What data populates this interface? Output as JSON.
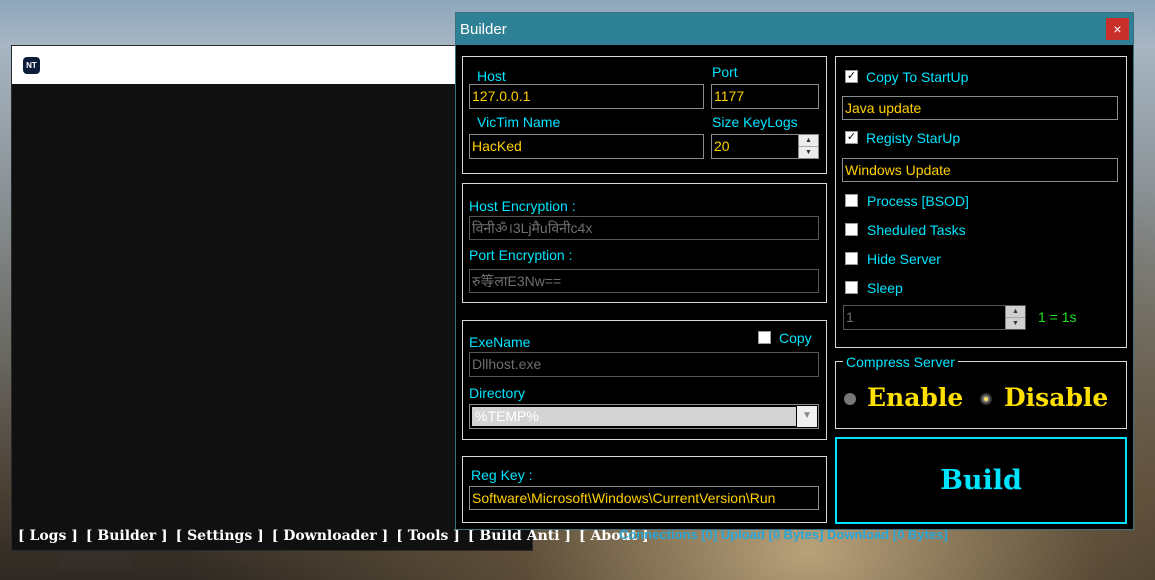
{
  "main": {
    "logo_text": "NT",
    "menu": [
      "[ Logs ]",
      "[ Builder ]",
      "[ Settings ]",
      "[ Downloader ]",
      "[ Tools ]",
      "[ Build Anti ]",
      "[ About ]"
    ],
    "status": "Connections [0]   Upload [0 Bytes]   Download [0 Bytes]"
  },
  "builder": {
    "title": "Builder",
    "close": "×",
    "host_label": "Host",
    "host_value": "127.0.0.1",
    "port_label": "Port",
    "port_value": "1177",
    "victim_label": "VicTim Name",
    "victim_value": "HacKed",
    "keylogs_label": "Size KeyLogs",
    "keylogs_value": "20",
    "host_enc_label": "Host Encryption :",
    "host_enc_value": "विनीॐ।3Ljमैuविनीc4x",
    "port_enc_label": "Port Encryption :",
    "port_enc_value": "रु等लाE3Nw==",
    "exename_label": "ExeName",
    "exename_value": "Dllhost.exe",
    "copy_label": "Copy",
    "directory_label": "Directory",
    "directory_value": "%TEMP%",
    "regkey_label": "Reg Key :",
    "regkey_value": "Software\\Microsoft\\Windows\\CurrentVersion\\Run",
    "copy_startup_label": "Copy To StartUp",
    "copy_startup_value": "Java update",
    "registry_label": "Registy StarUp",
    "registry_value": "Windows Update",
    "process_label": "Process [BSOD]",
    "tasks_label": "Sheduled Tasks",
    "hide_label": "Hide Server",
    "sleep_label": "Sleep",
    "sleep_value": "1",
    "sleep_hint": "1 = 1s",
    "compress_label": "Compress Server",
    "enable_label": "Enable",
    "disable_label": "Disable",
    "build_label": "Build",
    "check": "✓"
  }
}
